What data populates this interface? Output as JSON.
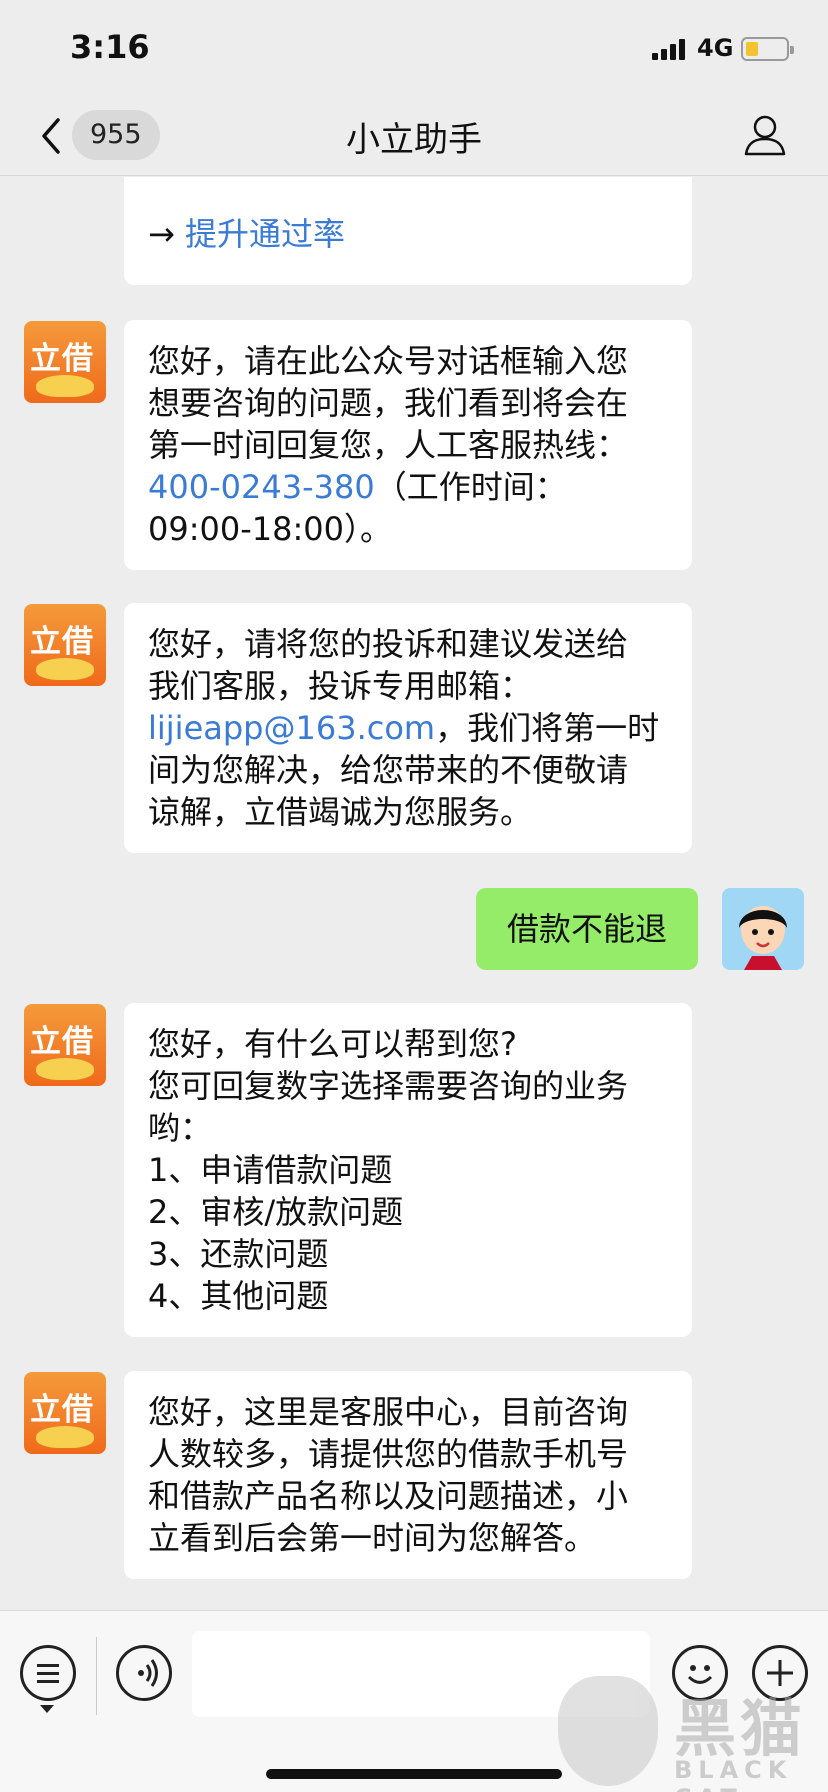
{
  "status_bar": {
    "time": "3:16",
    "network": "4G"
  },
  "nav": {
    "unread_count": "955",
    "title": "小立助手"
  },
  "messages": {
    "m0": {
      "arrow": "→",
      "link": "提升通过率"
    },
    "m1": {
      "l1": "您好，请在此公众号对话框输入您",
      "l2": "想要咨询的问题，我们看到将会在",
      "l3": "第一时间回复您，人工客服热线：",
      "phone": "400-0243-380",
      "l4_rest": "（工作时间：",
      "l5": "09:00-18:00）。"
    },
    "m2": {
      "l1": "您好，请将您的投诉和建议发送给",
      "l2": "我们客服，投诉专用邮箱：",
      "email": "lijieapp@163.com",
      "l3_rest": "，我们将第一时",
      "l4": "间为您解决，给您带来的不便敬请",
      "l5": "谅解，立借竭诚为您服务。"
    },
    "user": {
      "text": "借款不能退"
    },
    "m3": {
      "l1": "您好，有什么可以帮到您?",
      "l2": "您可回复数字选择需要咨询的业务",
      "l3": "哟：",
      "l4": "1、申请借款问题",
      "l5": "2、审核/放款问题",
      "l6": "3、还款问题",
      "l7": "4、其他问题"
    },
    "m4": {
      "l1": "您好，这里是客服中心，目前咨询",
      "l2": "人数较多，请提供您的借款手机号",
      "l3": "和借款产品名称以及问题描述，小",
      "l4": "立看到后会第一时间为您解答。"
    }
  },
  "avatar_logo": "立借",
  "watermark": {
    "text": "黑猫",
    "sub": "BLACK CAT"
  },
  "colors": {
    "link": "#3a7bd5",
    "user_bubble": "#95ec69",
    "logo_orange": "#ef6a1c"
  },
  "icons": [
    "back-icon",
    "profile-icon",
    "menu-icon",
    "voice-icon",
    "emoji-icon",
    "plus-icon"
  ]
}
